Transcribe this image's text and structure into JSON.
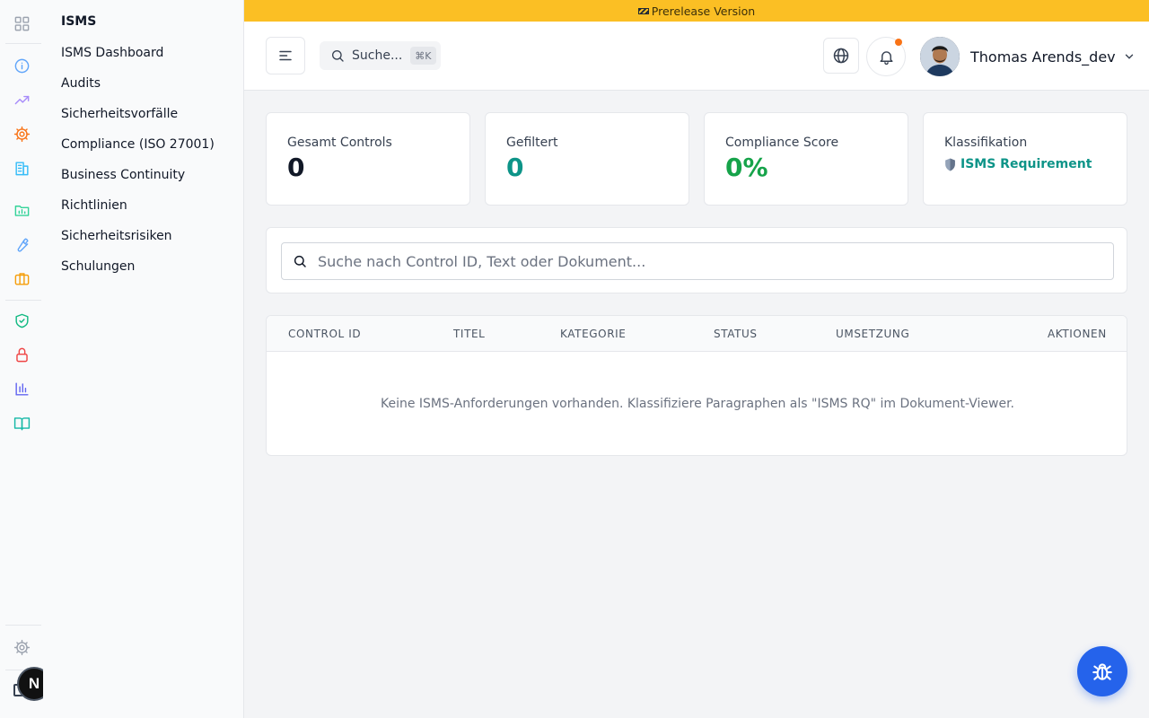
{
  "banner": {
    "text": "Prerelease Version"
  },
  "rail": {
    "icons": [
      "grid-icon",
      "info-icon",
      "trending-up-icon",
      "settings-cog-icon",
      "building-icon",
      "chart-folder-icon",
      "wrench-icon",
      "briefcase-icon",
      "shield-check-icon",
      "lock-icon",
      "bar-chart-icon",
      "book-open-icon",
      "gear-icon"
    ],
    "colors": {
      "info": "#60a5fa",
      "trend": "#a78bfa",
      "cog": "#f97316",
      "building": "#38bdf8",
      "folder": "#34d399",
      "wrench": "#60a5fa",
      "briefcase": "#f59e0b",
      "shield": "#10b981",
      "lock": "#ef4444",
      "chart": "#6366f1",
      "book": "#14b8a6"
    },
    "badge_letter": "N"
  },
  "subnav": {
    "title": "ISMS",
    "items": [
      {
        "label": "ISMS Dashboard"
      },
      {
        "label": "Audits"
      },
      {
        "label": "Sicherheitsvorfälle"
      },
      {
        "label": "Compliance (ISO 27001)"
      },
      {
        "label": "Business Continuity"
      },
      {
        "label": "Richtlinien"
      },
      {
        "label": "Sicherheitsrisiken"
      },
      {
        "label": "Schulungen"
      }
    ]
  },
  "header": {
    "search_label": "Suche...",
    "search_shortcut": "⌘K",
    "user_name": "Thomas Arends_dev"
  },
  "stats": [
    {
      "label": "Gesamt Controls",
      "value": "0",
      "color": "#111827"
    },
    {
      "label": "Gefiltert",
      "value": "0",
      "color": "#0d9488"
    },
    {
      "label": "Compliance Score",
      "value": "0%",
      "color": "#16a34a"
    },
    {
      "label": "Klassifikation",
      "link": "ISMS Requirement"
    }
  ],
  "search": {
    "placeholder": "Suche nach Control ID, Text oder Dokument..."
  },
  "table": {
    "columns": [
      "CONTROL ID",
      "TITEL",
      "KATEGORIE",
      "STATUS",
      "UMSETZUNG",
      "AKTIONEN"
    ],
    "empty_message": "Keine ISMS-Anforderungen vorhanden. Klassifiziere Paragraphen als \"ISMS RQ\" im Dokument-Viewer."
  },
  "colors": {
    "banner": "#fbbf24",
    "accent": "#0d9488",
    "fab": "#2563eb",
    "notification": "#f97316"
  }
}
